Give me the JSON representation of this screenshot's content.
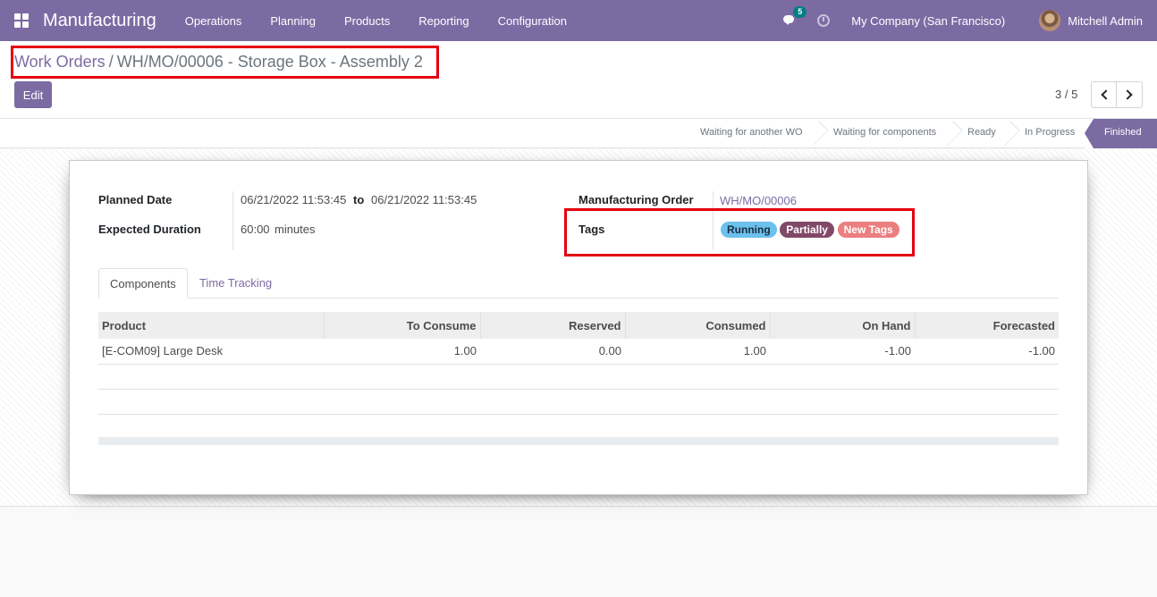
{
  "navbar": {
    "app_title": "Manufacturing",
    "menu": [
      "Operations",
      "Planning",
      "Products",
      "Reporting",
      "Configuration"
    ],
    "message_count": "5",
    "company": "My Company (San Francisco)",
    "user": "Mitchell Admin",
    "bg_color": "#7c6ba3"
  },
  "breadcrumb": {
    "parent": "Work Orders",
    "separator": "/",
    "current": "WH/MO/00006 - Storage Box - Assembly 2"
  },
  "actions": {
    "edit_label": "Edit"
  },
  "pager": {
    "value": "3 / 5"
  },
  "statusbar": {
    "stages": [
      "Waiting for another WO",
      "Waiting for components",
      "Ready",
      "In Progress",
      "Finished"
    ],
    "active": "Finished"
  },
  "form": {
    "planned_date_label": "Planned Date",
    "planned_date_start": "06/21/2022 11:53:45",
    "planned_date_to": "to",
    "planned_date_end": "06/21/2022 11:53:45",
    "expected_duration_label": "Expected Duration",
    "expected_duration_value": "60:00",
    "expected_duration_unit": "minutes",
    "mo_label": "Manufacturing Order",
    "mo_value": "WH/MO/00006",
    "tags_label": "Tags",
    "tags": [
      {
        "label": "Running",
        "color": "#6cc1ed"
      },
      {
        "label": "Partially",
        "color": "#814968"
      },
      {
        "label": "New Tags",
        "color": "#eb7e7f"
      }
    ]
  },
  "tabs": [
    {
      "label": "Components",
      "active": true
    },
    {
      "label": "Time Tracking",
      "active": false
    }
  ],
  "components_table": {
    "columns": [
      "Product",
      "To Consume",
      "Reserved",
      "Consumed",
      "On Hand",
      "Forecasted"
    ],
    "rows": [
      [
        "[E-COM09] Large Desk",
        "1.00",
        "0.00",
        "1.00",
        "-1.00",
        "-1.00"
      ]
    ]
  },
  "highlight_color": "#e4000f"
}
